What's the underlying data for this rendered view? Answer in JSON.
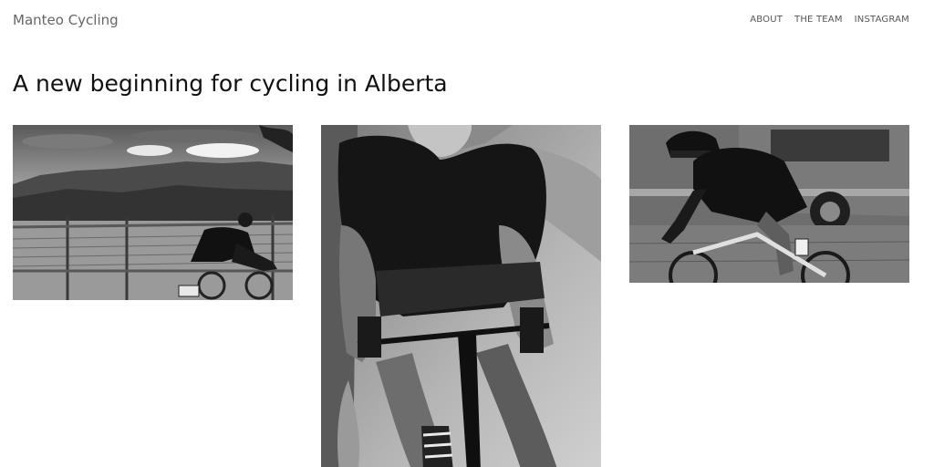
{
  "header": {
    "site_title": "Manteo Cycling",
    "nav": [
      {
        "label": "ABOUT"
      },
      {
        "label": "THE TEAM"
      },
      {
        "label": "INSTAGRAM"
      }
    ]
  },
  "main": {
    "headline": "A new beginning for cycling in Alberta",
    "gallery": [
      {
        "subject": "cyclist-vineyard-mountains"
      },
      {
        "subject": "cyclist-closeup-handlebars"
      },
      {
        "subject": "cyclist-passing-truck"
      }
    ]
  }
}
